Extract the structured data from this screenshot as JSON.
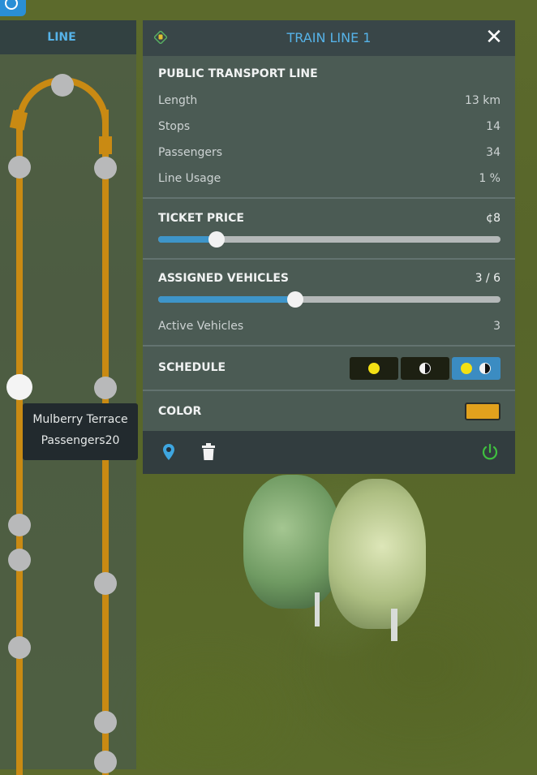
{
  "panel": {
    "title": "TRAIN LINE 1",
    "section_title": "PUBLIC TRANSPORT LINE",
    "stats": [
      {
        "label": "Length",
        "value": "13 km"
      },
      {
        "label": "Stops",
        "value": "14"
      },
      {
        "label": "Passengers",
        "value": "34"
      },
      {
        "label": "Line Usage",
        "value": "1 %"
      }
    ],
    "ticket": {
      "label": "TICKET PRICE",
      "value": "¢8",
      "slider_fraction": 0.17
    },
    "vehicles": {
      "label": "ASSIGNED VEHICLES",
      "value": "3 / 6",
      "slider_fraction": 0.4,
      "active_label": "Active Vehicles",
      "active_value": "3"
    },
    "schedule": {
      "label": "SCHEDULE",
      "options": [
        "day",
        "night",
        "day-and-night"
      ],
      "selected": "day-and-night"
    },
    "color": {
      "label": "COLOR",
      "value": "#e2a11d"
    },
    "footer_icons": [
      "location-pin-icon",
      "trash-icon",
      "power-icon"
    ]
  },
  "line_panel": {
    "title": "LINE",
    "line_color": "#c98a13"
  },
  "tooltip": {
    "stop_name": "Mulberry Terrace",
    "passengers_label": "Passengers",
    "passengers_value": "20"
  },
  "colors": {
    "accent": "#56b3e8",
    "slider": "#3e95c9",
    "power": "#3fbf3f"
  }
}
